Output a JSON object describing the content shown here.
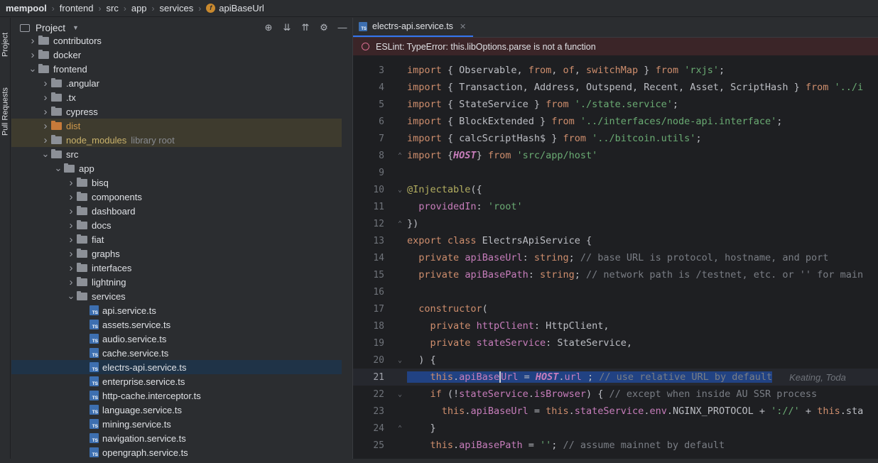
{
  "breadcrumb": [
    "mempool",
    "frontend",
    "src",
    "app",
    "services",
    "apiBaseUrl"
  ],
  "stripe": {
    "project": "Project",
    "pull_requests": "Pull Requests"
  },
  "project_panel": {
    "title": "Project"
  },
  "tree": [
    {
      "label": "contributors",
      "type": "folder",
      "depth": 0,
      "arrow": "right"
    },
    {
      "label": "docker",
      "type": "folder",
      "depth": 0,
      "arrow": "right"
    },
    {
      "label": "frontend",
      "type": "folder",
      "depth": 0,
      "arrow": "down"
    },
    {
      "label": ".angular",
      "type": "folder",
      "depth": 1,
      "arrow": "right"
    },
    {
      "label": ".tx",
      "type": "folder",
      "depth": 1,
      "arrow": "right"
    },
    {
      "label": "cypress",
      "type": "folder",
      "depth": 1,
      "arrow": "right"
    },
    {
      "label": "dist",
      "type": "folder-excluded",
      "depth": 1,
      "arrow": "right"
    },
    {
      "label": "node_modules",
      "type": "folder-lib",
      "depth": 1,
      "arrow": "right",
      "extra": "library root"
    },
    {
      "label": "src",
      "type": "folder",
      "depth": 1,
      "arrow": "down"
    },
    {
      "label": "app",
      "type": "folder",
      "depth": 2,
      "arrow": "down"
    },
    {
      "label": "bisq",
      "type": "folder",
      "depth": 3,
      "arrow": "right"
    },
    {
      "label": "components",
      "type": "folder",
      "depth": 3,
      "arrow": "right"
    },
    {
      "label": "dashboard",
      "type": "folder",
      "depth": 3,
      "arrow": "right"
    },
    {
      "label": "docs",
      "type": "folder",
      "depth": 3,
      "arrow": "right"
    },
    {
      "label": "fiat",
      "type": "folder",
      "depth": 3,
      "arrow": "right"
    },
    {
      "label": "graphs",
      "type": "folder",
      "depth": 3,
      "arrow": "right"
    },
    {
      "label": "interfaces",
      "type": "folder",
      "depth": 3,
      "arrow": "right"
    },
    {
      "label": "lightning",
      "type": "folder",
      "depth": 3,
      "arrow": "right"
    },
    {
      "label": "services",
      "type": "folder",
      "depth": 3,
      "arrow": "down"
    },
    {
      "label": "api.service.ts",
      "type": "ts",
      "depth": 4
    },
    {
      "label": "assets.service.ts",
      "type": "ts",
      "depth": 4
    },
    {
      "label": "audio.service.ts",
      "type": "ts",
      "depth": 4
    },
    {
      "label": "cache.service.ts",
      "type": "ts",
      "depth": 4
    },
    {
      "label": "electrs-api.service.ts",
      "type": "ts",
      "depth": 4,
      "selected": true
    },
    {
      "label": "enterprise.service.ts",
      "type": "ts",
      "depth": 4
    },
    {
      "label": "http-cache.interceptor.ts",
      "type": "ts",
      "depth": 4
    },
    {
      "label": "language.service.ts",
      "type": "ts",
      "depth": 4
    },
    {
      "label": "mining.service.ts",
      "type": "ts",
      "depth": 4
    },
    {
      "label": "navigation.service.ts",
      "type": "ts",
      "depth": 4
    },
    {
      "label": "opengraph.service.ts",
      "type": "ts",
      "depth": 4
    }
  ],
  "editor": {
    "tab_label": "electrs-api.service.ts",
    "lint_message": "ESLint: TypeError: this.libOptions.parse is not a function",
    "current_line": 21,
    "inlay_blame": "Keating, Toda"
  },
  "code": [
    {
      "n": "3",
      "fold": "",
      "t": [
        [
          "kw",
          "import"
        ],
        [
          "txt",
          " { Observable, "
        ],
        [
          "kw",
          "from"
        ],
        [
          "txt",
          ", "
        ],
        [
          "kw",
          "of"
        ],
        [
          "txt",
          ", "
        ],
        [
          "kw",
          "switchMap"
        ],
        [
          "txt",
          " } "
        ],
        [
          "kw",
          "from"
        ],
        [
          "txt",
          " "
        ],
        [
          "str",
          "'rxjs'"
        ],
        [
          "txt",
          ";"
        ]
      ]
    },
    {
      "n": "4",
      "fold": "",
      "t": [
        [
          "kw",
          "import"
        ],
        [
          "txt",
          " { Transaction, Address, Outspend, Recent, Asset, ScriptHash } "
        ],
        [
          "kw",
          "from"
        ],
        [
          "txt",
          " "
        ],
        [
          "str",
          "'../i"
        ]
      ]
    },
    {
      "n": "5",
      "fold": "",
      "t": [
        [
          "kw",
          "import"
        ],
        [
          "txt",
          " { StateService } "
        ],
        [
          "kw",
          "from"
        ],
        [
          "txt",
          " "
        ],
        [
          "str",
          "'./state.service'"
        ],
        [
          "txt",
          ";"
        ]
      ]
    },
    {
      "n": "6",
      "fold": "",
      "t": [
        [
          "kw",
          "import"
        ],
        [
          "txt",
          " { BlockExtended } "
        ],
        [
          "kw",
          "from"
        ],
        [
          "txt",
          " "
        ],
        [
          "str",
          "'../interfaces/node-api.interface'"
        ],
        [
          "txt",
          ";"
        ]
      ]
    },
    {
      "n": "7",
      "fold": "",
      "t": [
        [
          "kw",
          "import"
        ],
        [
          "txt",
          " { calcScriptHash$ } "
        ],
        [
          "kw",
          "from"
        ],
        [
          "txt",
          " "
        ],
        [
          "str",
          "'../bitcoin.utils'"
        ],
        [
          "txt",
          ";"
        ]
      ]
    },
    {
      "n": "8",
      "fold": "⌃",
      "t": [
        [
          "kw",
          "import"
        ],
        [
          "txt",
          " {"
        ],
        [
          "it",
          "HOST"
        ],
        [
          "txt",
          "} "
        ],
        [
          "kw",
          "from"
        ],
        [
          "txt",
          " "
        ],
        [
          "str",
          "'src/app/host'"
        ]
      ]
    },
    {
      "n": "9",
      "fold": "",
      "t": []
    },
    {
      "n": "10",
      "fold": "⌄",
      "t": [
        [
          "ann",
          "@Injectable"
        ],
        [
          "txt",
          "({"
        ]
      ]
    },
    {
      "n": "11",
      "fold": "",
      "t": [
        [
          "txt",
          "  "
        ],
        [
          "prop",
          "providedIn"
        ],
        [
          "txt",
          ": "
        ],
        [
          "str",
          "'root'"
        ]
      ]
    },
    {
      "n": "12",
      "fold": "⌃",
      "t": [
        [
          "txt",
          "})"
        ]
      ]
    },
    {
      "n": "13",
      "fold": "",
      "t": [
        [
          "kw",
          "export class"
        ],
        [
          "txt",
          " ElectrsApiService {"
        ]
      ]
    },
    {
      "n": "14",
      "fold": "",
      "t": [
        [
          "txt",
          "  "
        ],
        [
          "kw",
          "private"
        ],
        [
          "txt",
          " "
        ],
        [
          "prop",
          "apiBaseUrl"
        ],
        [
          "txt",
          ": "
        ],
        [
          "kw",
          "string"
        ],
        [
          "txt",
          "; "
        ],
        [
          "cm",
          "// base URL is protocol, hostname, and port"
        ]
      ]
    },
    {
      "n": "15",
      "fold": "",
      "t": [
        [
          "txt",
          "  "
        ],
        [
          "kw",
          "private"
        ],
        [
          "txt",
          " "
        ],
        [
          "prop",
          "apiBasePath"
        ],
        [
          "txt",
          ": "
        ],
        [
          "kw",
          "string"
        ],
        [
          "txt",
          "; "
        ],
        [
          "cm",
          "// network path is /testnet, etc. or '' for main"
        ]
      ]
    },
    {
      "n": "16",
      "fold": "",
      "t": []
    },
    {
      "n": "17",
      "fold": "",
      "t": [
        [
          "txt",
          "  "
        ],
        [
          "kw",
          "constructor"
        ],
        [
          "txt",
          "("
        ]
      ]
    },
    {
      "n": "18",
      "fold": "",
      "t": [
        [
          "txt",
          "    "
        ],
        [
          "kw",
          "private"
        ],
        [
          "txt",
          " "
        ],
        [
          "prop",
          "httpClient"
        ],
        [
          "txt",
          ": HttpClient,"
        ]
      ]
    },
    {
      "n": "19",
      "fold": "",
      "t": [
        [
          "txt",
          "    "
        ],
        [
          "kw",
          "private"
        ],
        [
          "txt",
          " "
        ],
        [
          "prop",
          "stateService"
        ],
        [
          "txt",
          ": StateService,"
        ]
      ]
    },
    {
      "n": "20",
      "fold": "⌄",
      "t": [
        [
          "txt",
          "  ) {"
        ]
      ]
    },
    {
      "n": "21",
      "fold": "",
      "t": [
        [
          "kw",
          "    this"
        ],
        [
          "txt",
          "."
        ],
        [
          "prop",
          "apiBase"
        ],
        [
          "caret",
          ""
        ],
        [
          "prop",
          "Url"
        ],
        [
          "txt",
          " = "
        ],
        [
          "it",
          "HOST"
        ],
        [
          "txt",
          "."
        ],
        [
          "prop",
          "url"
        ],
        [
          "txt",
          " ; "
        ],
        [
          "cm",
          "// use relative URL by default"
        ]
      ]
    },
    {
      "n": "22",
      "fold": "⌄",
      "t": [
        [
          "txt",
          "    "
        ],
        [
          "kw",
          "if"
        ],
        [
          "txt",
          " (!"
        ],
        [
          "prop",
          "stateService"
        ],
        [
          "txt",
          "."
        ],
        [
          "prop",
          "isBrowser"
        ],
        [
          "txt",
          ") { "
        ],
        [
          "cm",
          "// except when inside AU SSR process"
        ]
      ]
    },
    {
      "n": "23",
      "fold": "",
      "t": [
        [
          "txt",
          "      "
        ],
        [
          "kw",
          "this"
        ],
        [
          "txt",
          "."
        ],
        [
          "prop",
          "apiBaseUrl"
        ],
        [
          "txt",
          " = "
        ],
        [
          "kw",
          "this"
        ],
        [
          "txt",
          "."
        ],
        [
          "prop",
          "stateService"
        ],
        [
          "txt",
          "."
        ],
        [
          "prop",
          "env"
        ],
        [
          "txt",
          ".NGINX_PROTOCOL + "
        ],
        [
          "str",
          "'://'"
        ],
        [
          "txt",
          " + "
        ],
        [
          "kw",
          "this"
        ],
        [
          "txt",
          ".sta"
        ]
      ]
    },
    {
      "n": "24",
      "fold": "⌃",
      "t": [
        [
          "txt",
          "    }"
        ]
      ]
    },
    {
      "n": "25",
      "fold": "",
      "t": [
        [
          "kw",
          "    this"
        ],
        [
          "txt",
          "."
        ],
        [
          "prop",
          "apiBasePath"
        ],
        [
          "txt",
          " = "
        ],
        [
          "str",
          "''"
        ],
        [
          "txt",
          "; "
        ],
        [
          "cm",
          "// assume mainnet by default"
        ]
      ]
    }
  ]
}
